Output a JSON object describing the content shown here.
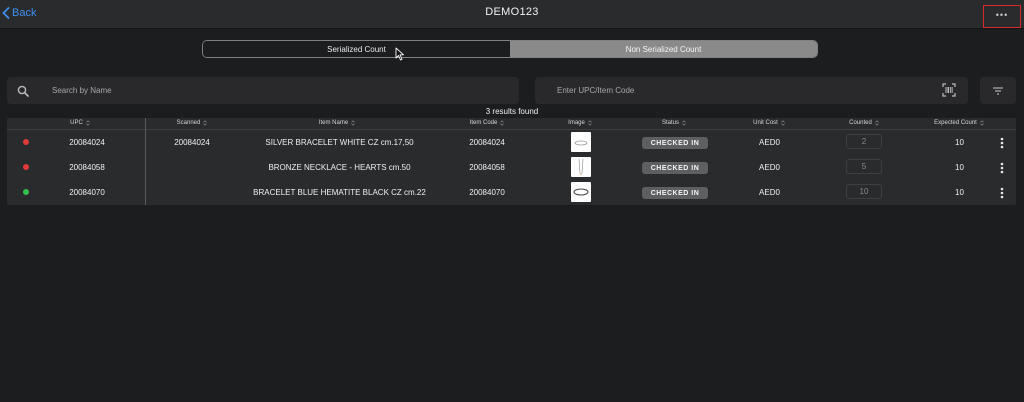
{
  "header": {
    "back_label": "Back",
    "title": "DEMO123",
    "more_label": "•••"
  },
  "segmented": {
    "tabs": [
      {
        "label": "Serialized Count",
        "active": true
      },
      {
        "label": "Non Serialized Count",
        "active": false
      }
    ]
  },
  "search": {
    "placeholder": "Search by Name",
    "value": ""
  },
  "upc_search": {
    "placeholder": "Enter UPC/Item Code",
    "value": ""
  },
  "results_text": "3 results found",
  "table": {
    "columns": [
      "UPC",
      "Scanned",
      "Item Name",
      "Item Code",
      "Image",
      "Status",
      "Unit Cost",
      "Counted",
      "Expected Count"
    ],
    "rows": [
      {
        "status_color": "#e03a3a",
        "upc": "20084024",
        "scanned": "20084024",
        "item_name": "SILVER BRACELET WHITE CZ cm.17,50",
        "item_code": "20084024",
        "image_icon": "bracelet-thumbnail",
        "status": "CHECKED IN",
        "unit_cost": "AED0",
        "counted": "2",
        "expected": "10"
      },
      {
        "status_color": "#e03a3a",
        "upc": "20084058",
        "scanned": "",
        "item_name": "BRONZE NECKLACE - HEARTS cm.50",
        "item_code": "20084058",
        "image_icon": "necklace-thumbnail",
        "status": "CHECKED IN",
        "unit_cost": "AED0",
        "counted": "5",
        "expected": "10"
      },
      {
        "status_color": "#33c24d",
        "upc": "20084070",
        "scanned": "",
        "item_name": "BRACELET BLUE HEMATITE BLACK CZ cm.22",
        "item_code": "20084070",
        "image_icon": "bracelet-thumbnail",
        "status": "CHECKED IN",
        "unit_cost": "AED0",
        "counted": "10",
        "expected": "10"
      }
    ]
  },
  "colors": {
    "accent_blue": "#3d8ff0",
    "highlight_red": "#d42a2a",
    "status_red": "#e03a3a",
    "status_green": "#33c24d"
  }
}
